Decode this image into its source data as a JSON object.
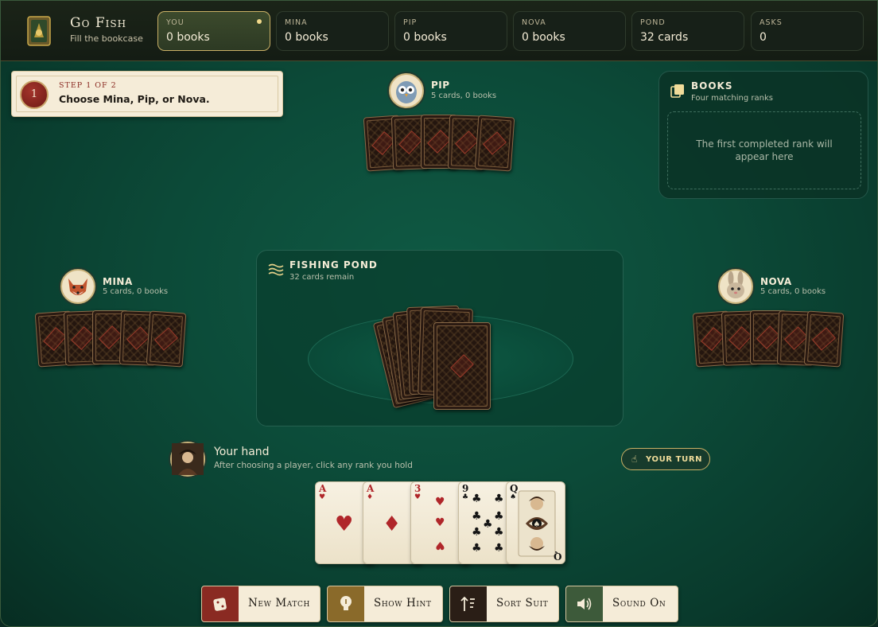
{
  "brand": {
    "title": "Go Fish",
    "subtitle": "Fill the bookcase",
    "logo_icon": "bookcase-logo-icon"
  },
  "stats": [
    {
      "label": "YOU",
      "value": "0 books",
      "active": true
    },
    {
      "label": "MINA",
      "value": "0 books"
    },
    {
      "label": "PIP",
      "value": "0 books"
    },
    {
      "label": "NOVA",
      "value": "0 books"
    },
    {
      "label": "POND",
      "value": "32 cards"
    },
    {
      "label": "ASKS",
      "value": "0"
    }
  ],
  "step": {
    "number": "1",
    "kicker": "STEP 1 OF 2",
    "text": "Choose Mina, Pip, or Nova."
  },
  "players": {
    "pip": {
      "name": "PIP",
      "info": "5 cards, 0 books",
      "avatar": "owl-avatar-icon",
      "cards": 5
    },
    "mina": {
      "name": "MINA",
      "info": "5 cards, 0 books",
      "avatar": "fox-avatar-icon",
      "cards": 5
    },
    "nova": {
      "name": "NOVA",
      "info": "5 cards, 0 books",
      "avatar": "rabbit-avatar-icon",
      "cards": 5
    }
  },
  "books": {
    "title": "BOOKS",
    "subtitle": "Four matching ranks",
    "empty": "The first completed rank will appear here",
    "icon": "books-icon"
  },
  "pond": {
    "title": "FISHING POND",
    "subtitle": "32 cards remain",
    "icon": "waves-icon"
  },
  "hand": {
    "title": "Your hand",
    "subtitle": "After choosing a player, click any rank you hold",
    "turn": "YOUR TURN",
    "cards": [
      {
        "rank": "A",
        "suit": "♥",
        "color": "red"
      },
      {
        "rank": "A",
        "suit": "♦",
        "color": "red"
      },
      {
        "rank": "3",
        "suit": "♥",
        "color": "red"
      },
      {
        "rank": "9",
        "suit": "♣",
        "color": "black"
      },
      {
        "rank": "Q",
        "suit": "♠",
        "color": "black"
      }
    ]
  },
  "buttons": [
    {
      "label": "New Match",
      "icon": "dice-icon",
      "color": "#8a2a22"
    },
    {
      "label": "Show Hint",
      "icon": "lightbulb-icon",
      "color": "#8a6a2a"
    },
    {
      "label": "Sort Suit",
      "icon": "sort-icon",
      "color": "#2a1e16"
    },
    {
      "label": "Sound On",
      "icon": "speaker-icon",
      "color": "#3d5a3a"
    }
  ]
}
